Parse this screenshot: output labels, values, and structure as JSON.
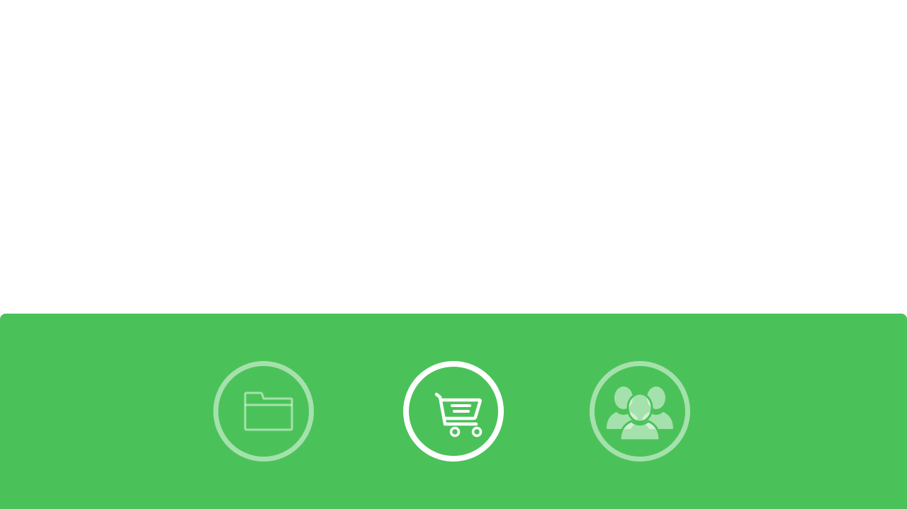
{
  "colors": {
    "panel_background": "#4bc259",
    "page_background": "#ffffff",
    "active_icon": "#ffffff",
    "inactive_icon": "rgba(255,255,255,0.5)"
  },
  "bottom_nav": {
    "active_item": "cart",
    "items": [
      {
        "id": "folder",
        "icon": "folder-icon",
        "state": "inactive"
      },
      {
        "id": "cart",
        "icon": "shopping-cart-icon",
        "state": "active"
      },
      {
        "id": "people",
        "icon": "users-group-icon",
        "state": "inactive"
      }
    ]
  }
}
